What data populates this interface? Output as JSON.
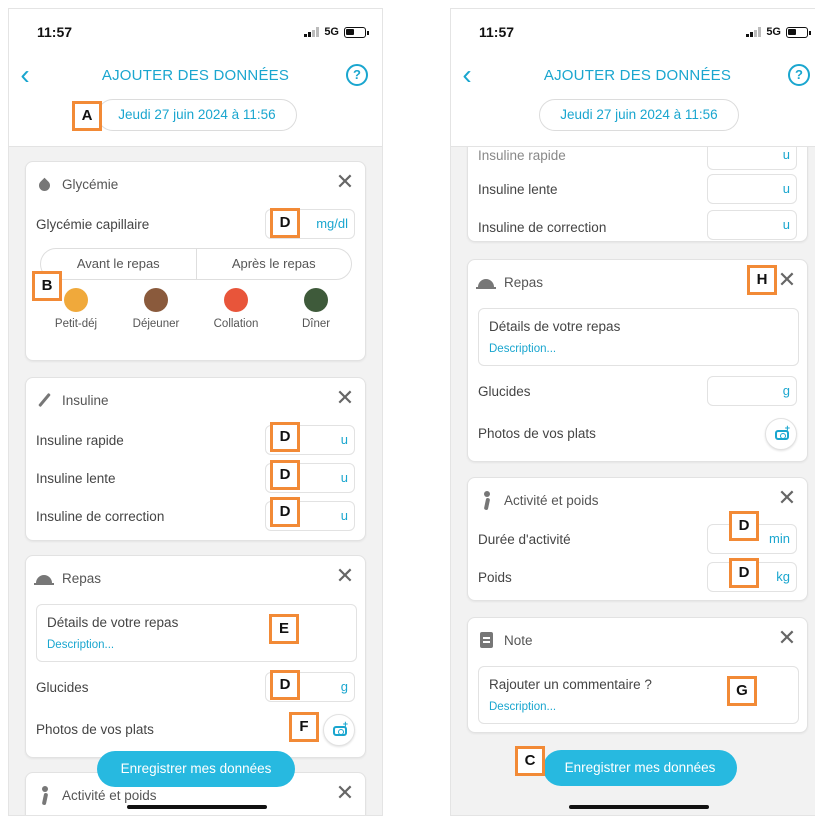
{
  "status": {
    "time": "11:57",
    "network": "5G"
  },
  "header": {
    "title": "AJOUTER DES DONNÉES",
    "help": "?",
    "back": "‹",
    "date": "Jeudi 27 juin 2024 à 11:56"
  },
  "glycemie": {
    "title": "Glycémie",
    "field_label": "Glycémie capillaire",
    "unit": "mg/dl",
    "segment": [
      "Avant le repas",
      "Après le repas"
    ],
    "meals": [
      {
        "name": "Petit-déj",
        "color": "#f0a93b"
      },
      {
        "name": "Déjeuner",
        "color": "#8a5a3c"
      },
      {
        "name": "Collation",
        "color": "#e8553a"
      },
      {
        "name": "Dîner",
        "color": "#3e5a3a"
      }
    ]
  },
  "insuline": {
    "title": "Insuline",
    "fields": [
      {
        "label": "Insuline rapide",
        "unit": "u"
      },
      {
        "label": "Insuline lente",
        "unit": "u"
      },
      {
        "label": "Insuline de correction",
        "unit": "u"
      }
    ],
    "partial_top": "Insuline rapide"
  },
  "repas": {
    "title": "Repas",
    "details_title": "Détails de votre repas",
    "details_placeholder": "Description...",
    "glucides_label": "Glucides",
    "glucides_unit": "g",
    "photos_label": "Photos de vos plats"
  },
  "activite": {
    "title": "Activité et poids",
    "fields": [
      {
        "label": "Durée d'activité",
        "unit": "min"
      },
      {
        "label": "Poids",
        "unit": "kg"
      }
    ]
  },
  "note": {
    "title": "Note",
    "comment_title": "Rajouter un commentaire ?",
    "comment_placeholder": "Description..."
  },
  "actions": {
    "save_label": "Enregistrer mes données",
    "close": "✕"
  },
  "annotations": {
    "A": "A",
    "B": "B",
    "C": "C",
    "D": "D",
    "E": "E",
    "F": "F",
    "G": "G",
    "H": "H"
  },
  "colors": {
    "accent": "#1aa6cf",
    "button": "#27b9e0",
    "annotation_border": "#f28a36"
  }
}
